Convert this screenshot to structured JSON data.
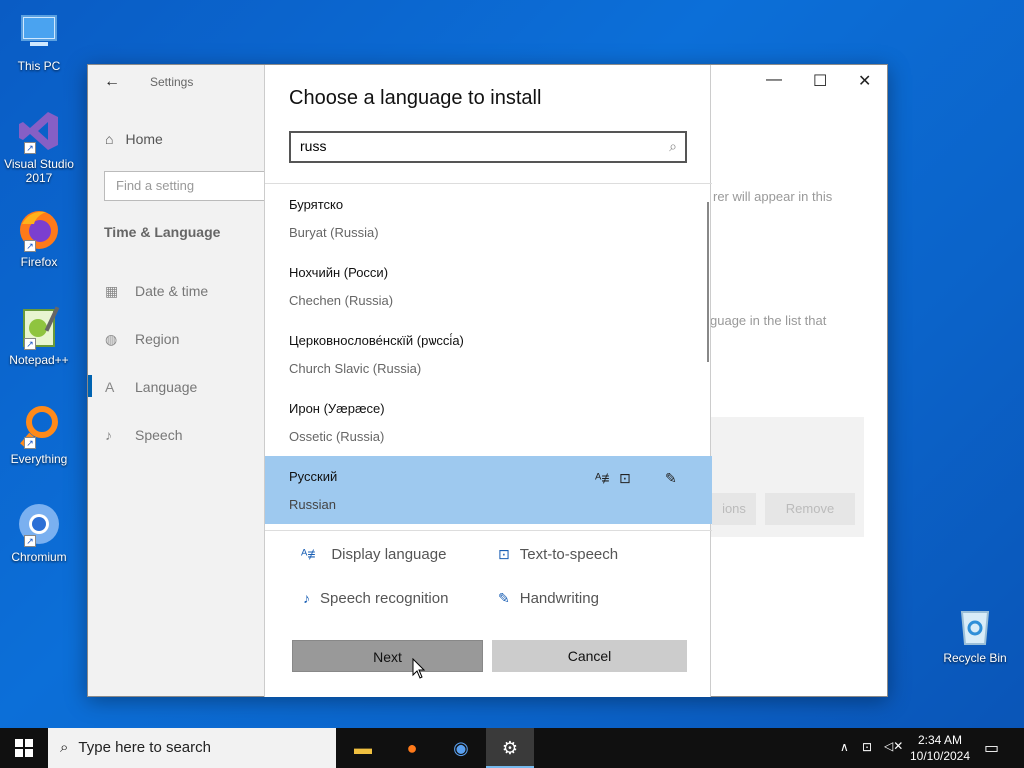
{
  "desktop": {
    "icons": [
      {
        "label": "This PC",
        "icon": "computer-icon"
      },
      {
        "label": "Visual Studio 2017",
        "icon": "visual-studio-icon"
      },
      {
        "label": "Firefox",
        "icon": "firefox-icon"
      },
      {
        "label": "Notepad++",
        "icon": "notepad-plus-plus-icon"
      },
      {
        "label": "Everything",
        "icon": "everything-search-icon"
      },
      {
        "label": "Chromium",
        "icon": "chromium-icon"
      },
      {
        "label": "Recycle Bin",
        "icon": "recycle-bin-icon"
      }
    ]
  },
  "settings": {
    "title": "Settings",
    "home": "Home",
    "search_placeholder": "Find a setting",
    "section": "Time & Language",
    "nav": [
      {
        "label": "Date & time",
        "icon": "clock-icon"
      },
      {
        "label": "Region",
        "icon": "globe-icon"
      },
      {
        "label": "Language",
        "icon": "language-icon",
        "active": true
      },
      {
        "label": "Speech",
        "icon": "microphone-icon"
      }
    ],
    "behind_text_1": "rer will appear in this",
    "behind_text_2": "guage in the list that",
    "behind_btn_options": "ions",
    "behind_btn_remove": "Remove"
  },
  "dialog": {
    "title": "Choose a language to install",
    "search_value": "russ",
    "languages": [
      {
        "native": "Бурятско",
        "english": "Buryat (Russia)",
        "selected": false
      },
      {
        "native": "Нохчийн (Росси)",
        "english": "Chechen (Russia)",
        "selected": false
      },
      {
        "native": "Церковнослове́нскїй (рѡссі́а)",
        "english": "Church Slavic (Russia)",
        "selected": false
      },
      {
        "native": "Ирон (Уæрæсе)",
        "english": "Ossetic (Russia)",
        "selected": false
      },
      {
        "native": "Русский",
        "english": "Russian",
        "selected": true
      }
    ],
    "features": {
      "display_language": "Display language",
      "text_to_speech": "Text-to-speech",
      "speech_recognition": "Speech recognition",
      "handwriting": "Handwriting"
    },
    "next_label": "Next",
    "cancel_label": "Cancel"
  },
  "taskbar": {
    "search_placeholder": "Type here to search",
    "time": "2:34 AM",
    "date": "10/10/2024"
  },
  "colors": {
    "selected_row": "#9ec9ef",
    "desktop_blue": "#0c6fd8",
    "accent": "#0063b1"
  }
}
